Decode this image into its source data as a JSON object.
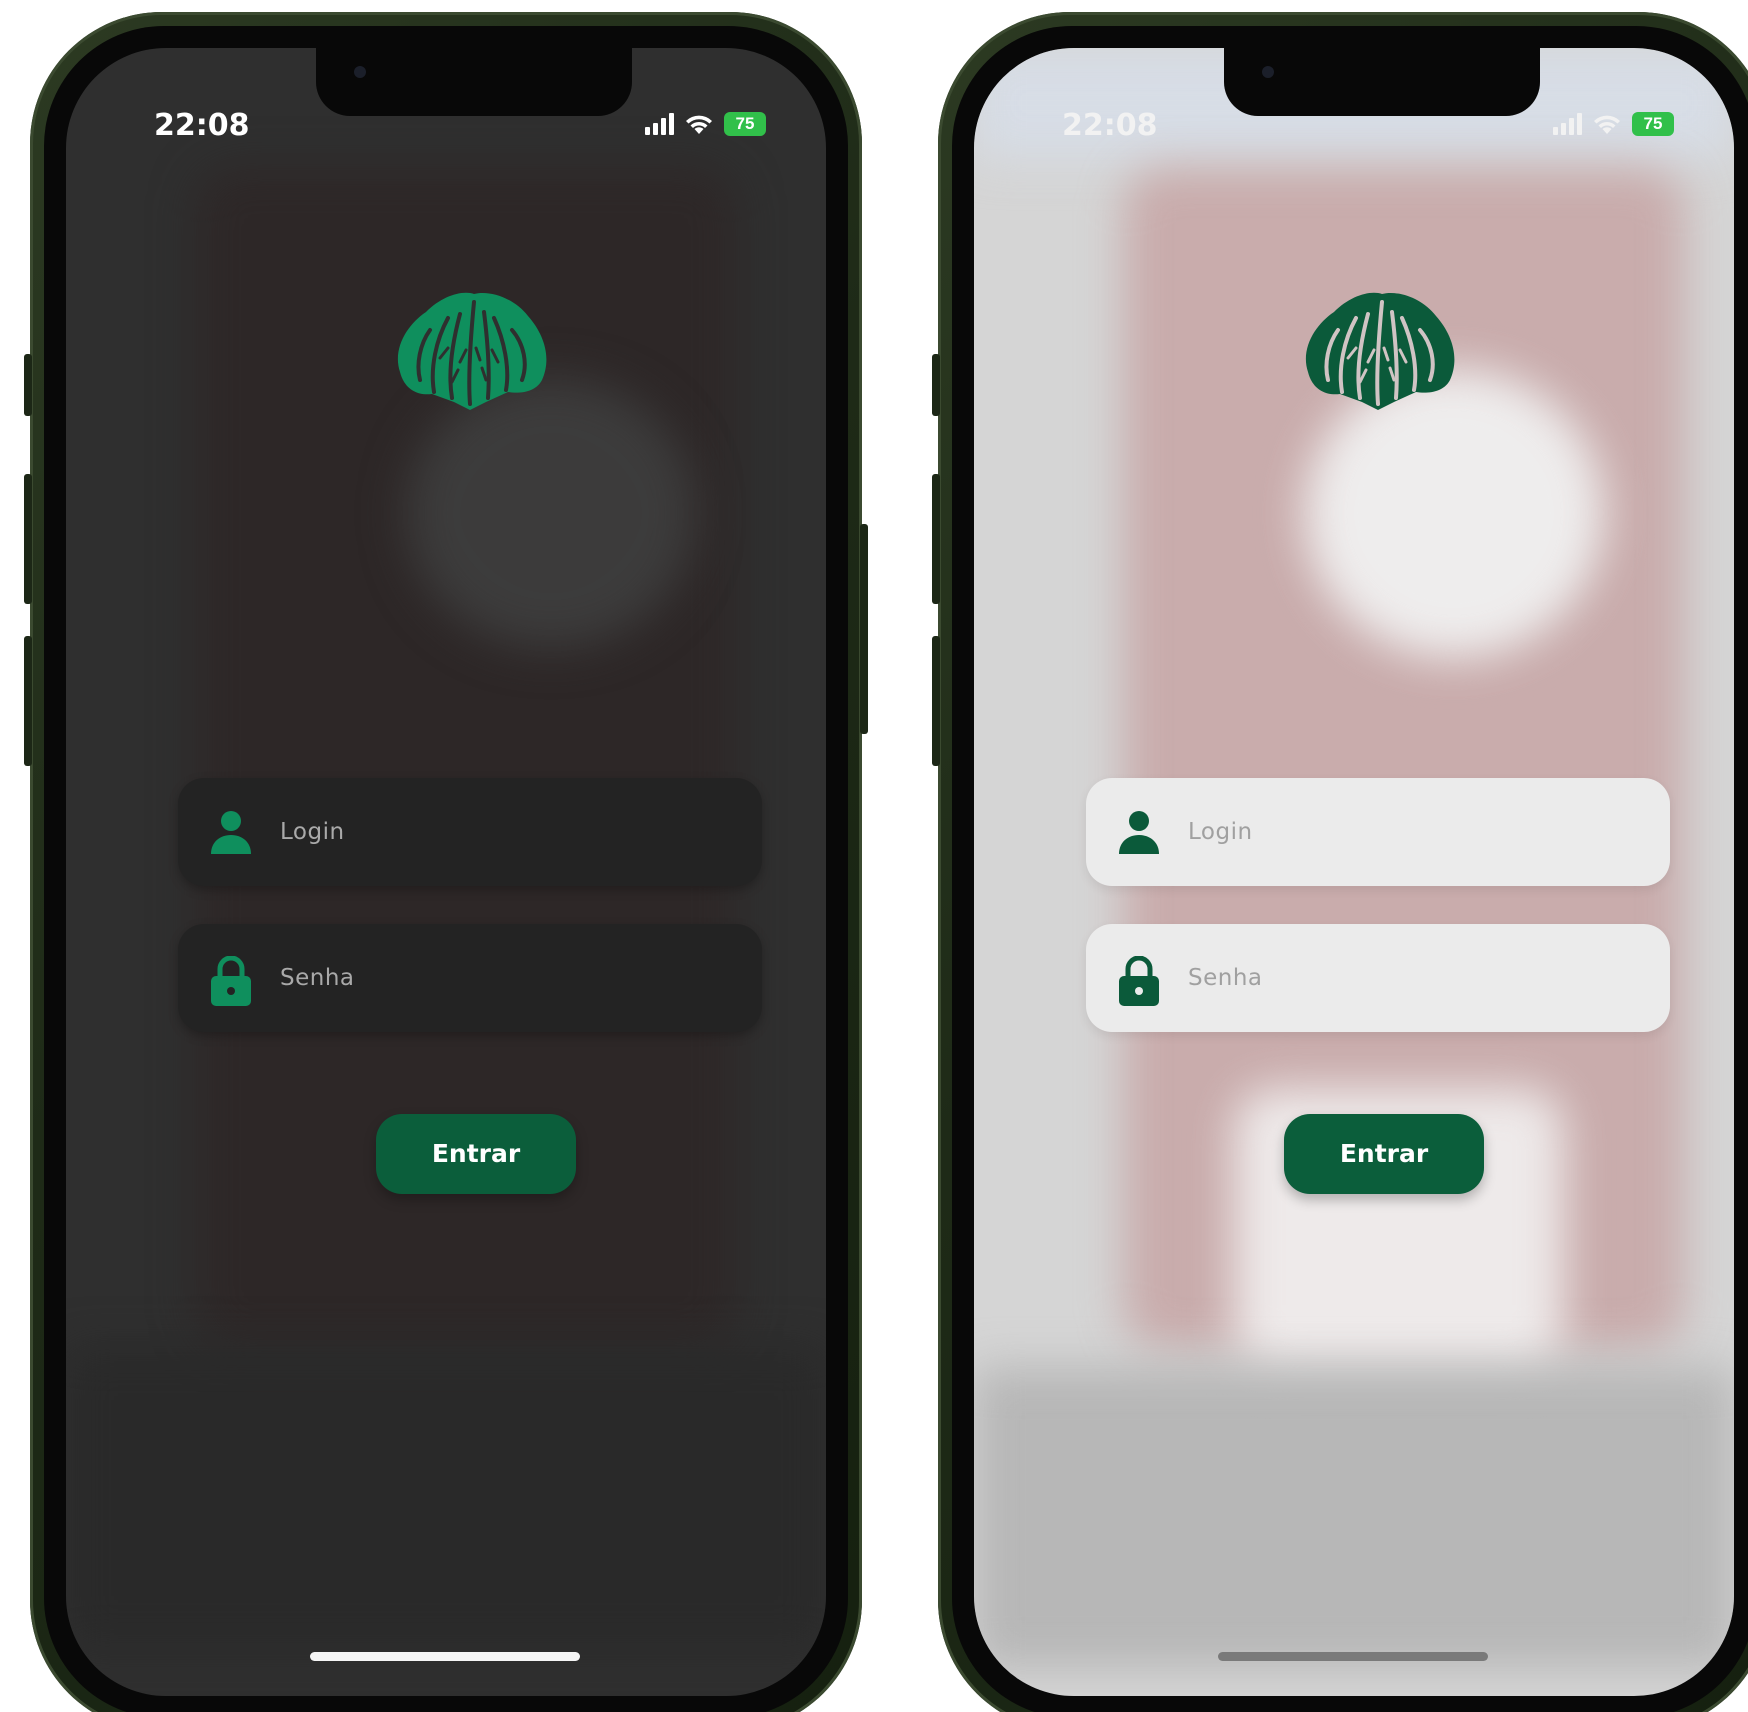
{
  "screens": [
    {
      "theme": "dark",
      "status_bar": {
        "time": "22:08",
        "battery": "75"
      },
      "login": {
        "placeholder": "Login"
      },
      "password": {
        "placeholder": "Senha"
      },
      "submit": {
        "label": "Entrar"
      }
    },
    {
      "theme": "light",
      "status_bar": {
        "time": "22:08",
        "battery": "75"
      },
      "login": {
        "placeholder": "Login"
      },
      "password": {
        "placeholder": "Senha"
      },
      "submit": {
        "label": "Entrar"
      }
    }
  ],
  "colors": {
    "accent_green": "#0b8a5c",
    "button_green": "#0b5e3b",
    "icon_green_dark_theme": "#0f8f5d",
    "icon_green_light_theme": "#0b5a3a",
    "battery_green": "#31c04a"
  },
  "icons": {
    "logo": "agave-plant-logo",
    "login": "user-icon",
    "password": "lock-icon"
  }
}
